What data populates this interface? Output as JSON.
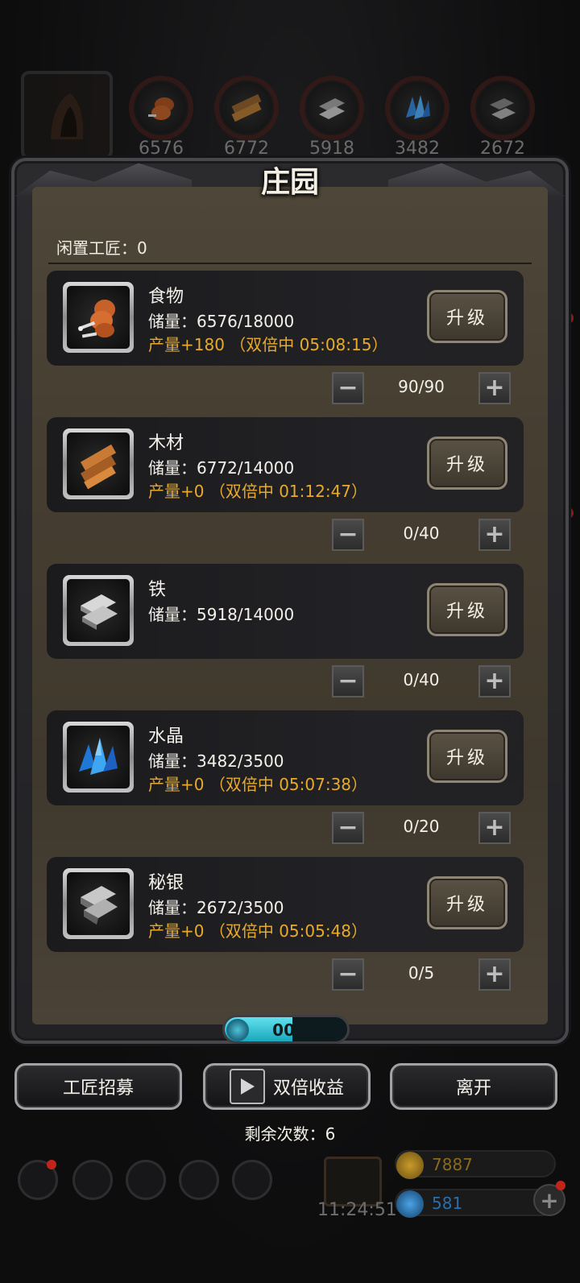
{
  "top_resources": [
    {
      "icon": "food-icon",
      "value": "6576"
    },
    {
      "icon": "wood-icon",
      "value": "6772"
    },
    {
      "icon": "iron-icon",
      "value": "5918"
    },
    {
      "icon": "crystal-icon",
      "value": "3482"
    },
    {
      "icon": "mithril-icon",
      "value": "2672"
    }
  ],
  "panel": {
    "title": "庄园",
    "idle_label": "闲置工匠：0",
    "upgrade_label": "升级"
  },
  "resources": [
    {
      "name": "食物",
      "stock": "储量：6576/18000",
      "production": "产量+180 （双倍中 05:08:15）",
      "workers": "90/90",
      "icon": "food-icon"
    },
    {
      "name": "木材",
      "stock": "储量：6772/14000",
      "production": "产量+0 （双倍中 01:12:47）",
      "workers": "0/40",
      "icon": "wood-icon"
    },
    {
      "name": "铁",
      "stock": "储量：5918/14000",
      "production": "",
      "workers": "0/40",
      "icon": "iron-icon"
    },
    {
      "name": "水晶",
      "stock": "储量：3482/3500",
      "production": "产量+0 （双倍中 05:07:38）",
      "workers": "0/20",
      "icon": "crystal-icon"
    },
    {
      "name": "秘银",
      "stock": "储量：2672/3500",
      "production": "产量+0 （双倍中 05:05:48）",
      "workers": "0/5",
      "icon": "mithril-icon"
    }
  ],
  "stepper": {
    "minus": "−",
    "plus": "+"
  },
  "timer": {
    "text": "00:17",
    "progress": 0.55
  },
  "buttons": {
    "recruit": "工匠招募",
    "double": "双倍收益",
    "leave": "离开"
  },
  "remaining": "剩余次数：6",
  "hud": {
    "clock": "11:24:51",
    "gold": "7887",
    "gems": "581",
    "add": "+"
  },
  "colors": {
    "production_text": "#e7aa2c",
    "timer_fill": "#3fc9dc",
    "gold_text": "#8a6a1e",
    "gem_text": "#2a6fa8"
  }
}
